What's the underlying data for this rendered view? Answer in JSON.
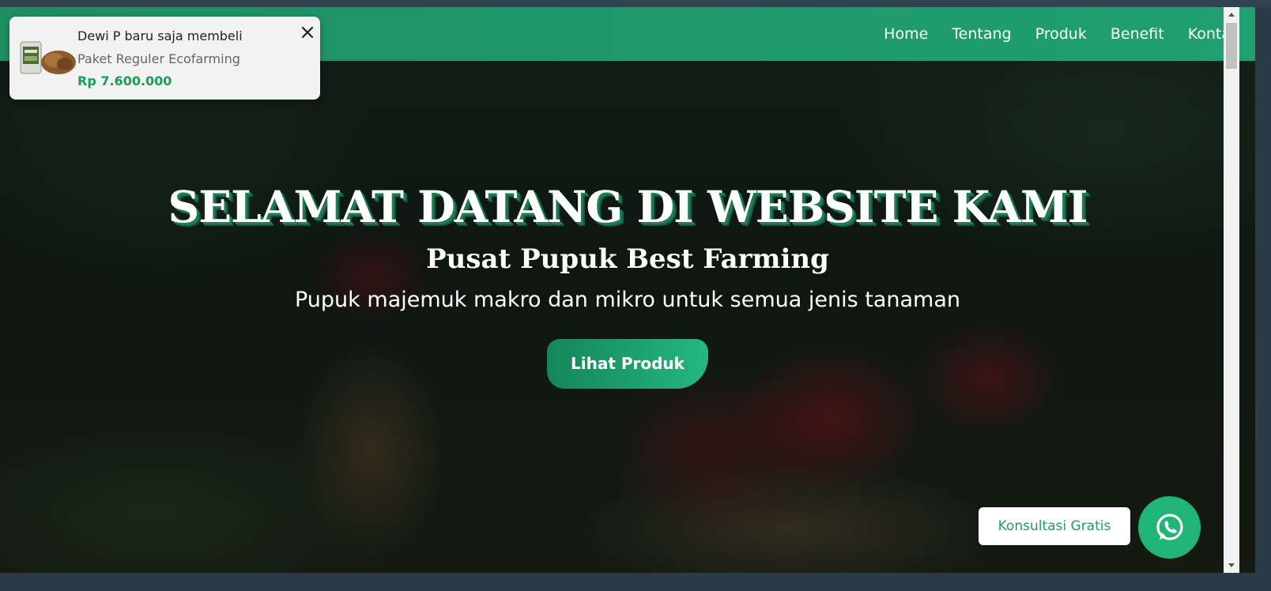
{
  "nav": {
    "links": [
      "Home",
      "Tentang",
      "Produk",
      "Benefit",
      "Kontak"
    ]
  },
  "hero": {
    "title": "SELAMAT DATANG DI WEBSITE KAMI",
    "subtitle": "Pusat Pupuk Best Farming",
    "description": "Pupuk majemuk makro dan mikro untuk semua jenis tanaman",
    "cta_label": "Lihat Produk"
  },
  "notification": {
    "buyer_text": "Dewi P baru saja membeli",
    "product": "Paket Reguler Ecofarming",
    "price": "Rp 7.600.000",
    "close_icon": "close-icon",
    "product_image_icon": "product-thumbnail"
  },
  "consult": {
    "label": "Konsultasi Gratis",
    "icon": "whatsapp-icon"
  },
  "colors": {
    "primary_green": "#1f9e6a",
    "price_green": "#1a9e55",
    "whatsapp_green": "#20b476"
  }
}
